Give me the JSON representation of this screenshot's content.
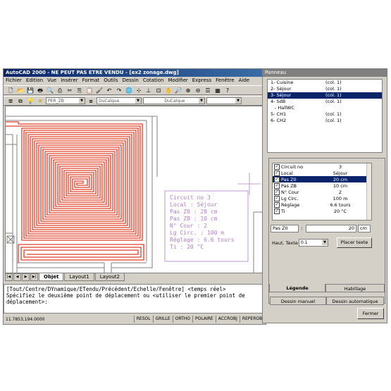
{
  "window": {
    "title": "AutoCAD 2000 - NE PEUT PAS ETRE VENDU - [ex2 zonage.dwg]",
    "controls": [
      "_",
      "□",
      "×"
    ]
  },
  "menu": [
    "Fichier",
    "Edition",
    "Vue",
    "Insérer",
    "Format",
    "Outils",
    "Dessin",
    "Cotation",
    "Modifier",
    "Express",
    "Fenêtre",
    "Aide"
  ],
  "layers_bar": {
    "layer_name": "PER_ZB",
    "color": "DuCalque",
    "linetype": "DuCalque"
  },
  "annotation": {
    "lines": [
      "Circuit no 3",
      "Local : Séjour",
      "Pas Z0 : 20 cm",
      "Pas ZB : 10 cm",
      "N° Cour : 2",
      "Lg Circ. : 100 m",
      "Réglage : 6.6 tours",
      "Ti : 20 °C"
    ],
    "color": "#b080c8"
  },
  "layout_tabs": [
    "Objet",
    "Layout1",
    "Layout2"
  ],
  "command": {
    "lines": [
      "[Tout/Centre/DYnamique/ETendu/Précédent/Echelle/Fenêtre] <temps réel>",
      "Spécifiez le deuxième point de déplacement ou <utiliser le premier point de",
      "déplacement>:"
    ]
  },
  "status": {
    "coords": "11.7853,194.0000",
    "toggles": [
      "RESOL",
      "GRILLE",
      "ORTHO",
      "POLAIRE",
      "ACCROBJ",
      "REPEROBJ"
    ]
  },
  "panel": {
    "title": "Panneau",
    "circuits": [
      {
        "name": "1- Cuisine",
        "col": "(col. 1)"
      },
      {
        "name": "2- Séjour",
        "col": "(col. 1)"
      },
      {
        "name": "3- Séjour",
        "col": "(col. 1)"
      },
      {
        "name": "4- SdB",
        "col": "(col. 1)"
      },
      {
        "name": "- HallWC",
        "col": ""
      },
      {
        "name": "5- CH1",
        "col": "(col. 1)"
      },
      {
        "name": "6- CH2",
        "col": "(col. 1)"
      }
    ],
    "selected_circuit_index": 2,
    "properties": [
      {
        "name": "Circuit no",
        "value": "3"
      },
      {
        "name": "Local",
        "value": "Séjour"
      },
      {
        "name": "Pas Z0",
        "value": "20 cm"
      },
      {
        "name": "Pas ZB",
        "value": "10 cm"
      },
      {
        "name": "N° Cour",
        "value": "2"
      },
      {
        "name": "Lg Circ.",
        "value": "100 m"
      },
      {
        "name": "Réglage",
        "value": "6.6 tours"
      },
      {
        "name": "Ti",
        "value": "20 °C"
      }
    ],
    "selected_property_index": 2,
    "edit": {
      "label": "Pas Z0",
      "colon": ":",
      "value": "20",
      "unit": "cm"
    },
    "text_height": {
      "label": "Haut. Texte",
      "value": "0.1"
    },
    "place_button": "Placer texte",
    "tabs": [
      "Légende",
      "Habillage"
    ],
    "bottom_tabs": [
      "Dessin manuel",
      "Dessin automatique"
    ],
    "close_button": "Fermer"
  },
  "colors": {
    "pipe": "#e0402a",
    "wall": "#808080",
    "title_bar": "#0a246a"
  }
}
